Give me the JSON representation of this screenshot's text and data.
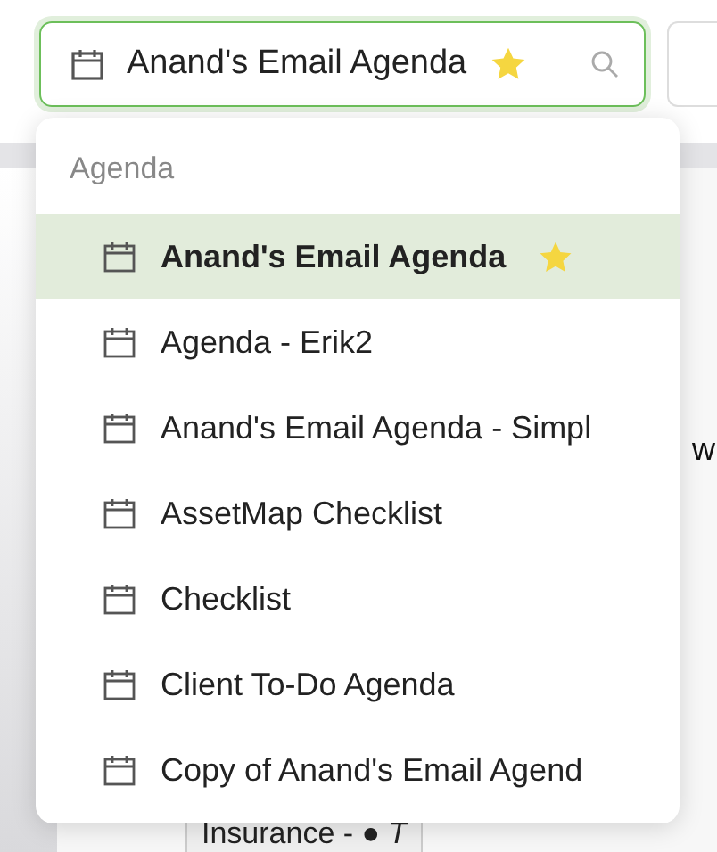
{
  "search": {
    "value": "Anand's Email Agenda",
    "starred": true
  },
  "dropdown": {
    "section": "Agenda",
    "items": [
      {
        "label": "Anand's Email Agenda",
        "selected": true,
        "starred": true
      },
      {
        "label": "Agenda - Erik2",
        "selected": false,
        "starred": false
      },
      {
        "label": "Anand's Email Agenda - Simpl",
        "selected": false,
        "starred": false
      },
      {
        "label": "AssetMap Checklist",
        "selected": false,
        "starred": false
      },
      {
        "label": "Checklist",
        "selected": false,
        "starred": false
      },
      {
        "label": "Client To-Do Agenda",
        "selected": false,
        "starred": false
      },
      {
        "label": "Copy of Anand's Email Agend",
        "selected": false,
        "starred": false
      }
    ]
  },
  "background": {
    "partial_text": "w",
    "chip": "Insurance - ● *T*"
  }
}
